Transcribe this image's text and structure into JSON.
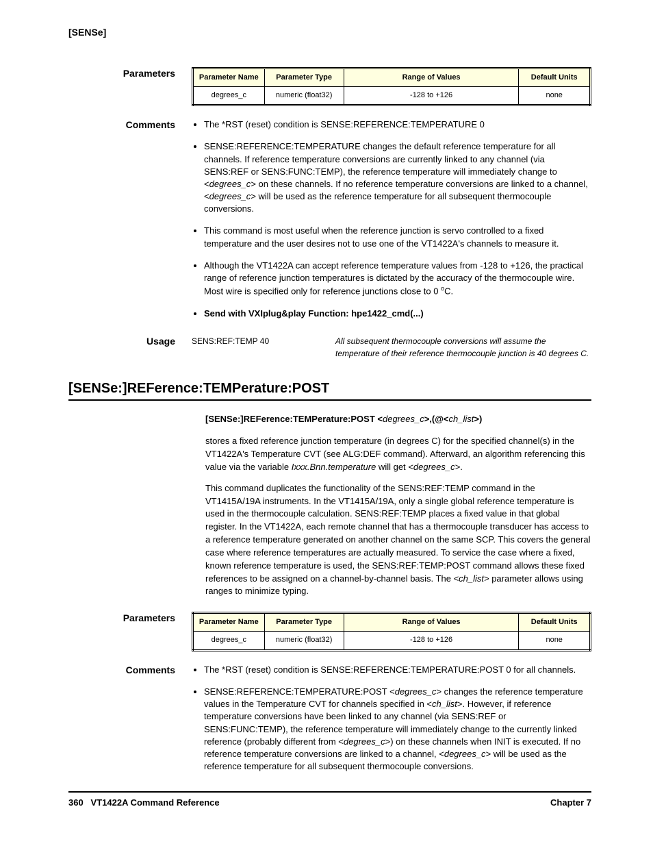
{
  "header": {
    "category": "[SENSe]"
  },
  "sec1": {
    "params_label": "Parameters",
    "table": {
      "headers": [
        "Parameter Name",
        "Parameter Type",
        "Range of Values",
        "Default Units"
      ],
      "row": [
        "degrees_c",
        "numeric (float32)",
        "-128 to +126",
        "none"
      ]
    },
    "comments_label": "Comments",
    "comments": {
      "c1": "The *RST (reset) condition is SENSE:REFERENCE:TEMPERATURE 0",
      "c2_a": "SENSE:REFERENCE:TEMPERATURE changes the default reference temperature for all channels. If reference temperature conversions are currently linked to any channel (via SENS:REF or SENS:FUNC:TEMP), the reference temperature will immediately change to <",
      "c2_b": "> on these channels. If no reference temperature conversions are linked to a channel, <",
      "c2_c": "> will be used as the reference temperature for all subsequent thermocouple conversions.",
      "c2_i": "degrees_c",
      "c3": "This command is most useful when the reference junction is servo controlled to a fixed temperature and the user desires not to use one of the VT1422A's channels to measure it.",
      "c4_a": "Although the VT1422A can accept reference temperature values from -128 to +126, the practical range of reference junction temperatures is dictated by the accuracy of the thermocouple wire. Most wire is specified only for reference junctions close to 0 ",
      "c4_b": "C.",
      "c5": "Send with VXIplug&play Function: hpe1422_cmd(...)"
    },
    "usage_label": "Usage",
    "usage": {
      "cmd": "SENS:REF:TEMP 40",
      "comment": "All subsequent thermocouple conversions will assume the temperature of their reference thermocouple junction is 40 degrees C."
    }
  },
  "cmd2": {
    "heading": "[SENSe:]REFerence:TEMPerature:POST",
    "syntax": {
      "bold_a": "[SENSe:]REFerence:TEMPerature:POST  <",
      "i1": "degrees_c",
      "bold_b": ">,(@<",
      "i2": "ch_list",
      "bold_c": ">)"
    },
    "desc": {
      "p1_a": "stores a fixed reference junction temperature (in degrees C) for the specified channel(s) in the VT1422A's Temperature CVT (see ALG:DEF command). Afterward, an algorithm referencing this value via the variable ",
      "p1_b": " will get ",
      "p1_c": ".",
      "p1_i1": "Ixxx.Bnn.temperature",
      "p1_i2": "<degrees_c>",
      "p2_a": "This command duplicates the functionality of the SENS:REF:TEMP command in the VT1415A/19A instruments. In the VT1415A/19A, only a single global reference temperature is used in the thermocouple calculation. SENS:REF:TEMP places a fixed value in that global register. In the VT1422A, each remote channel that has a thermocouple transducer has access to a reference temperature generated on another channel on the same SCP. This covers the general case where reference temperatures are actually measured. To service the case where a fixed, known reference temperature is used, the SENS:REF:TEMP:POST command allows these fixed references to be assigned on a channel-by-channel basis. The ",
      "p2_b": " parameter allows using ranges to minimize typing.",
      "p2_i": "<ch_list>"
    },
    "params_label": "Parameters",
    "table": {
      "headers": [
        "Parameter Name",
        "Parameter Type",
        "Range of Values",
        "Default Units"
      ],
      "row": [
        "degrees_c",
        "numeric (float32)",
        "-128 to +126",
        "none"
      ]
    },
    "comments_label": "Comments",
    "comments": {
      "c1": "The *RST (reset) condition is SENSE:REFERENCE:TEMPERATURE:POST 0 for all channels.",
      "c2_a": "SENSE:REFERENCE:TEMPERATURE:POST <",
      "c2_b": "> changes the reference temperature values in the Temperature CVT for channels specified in <",
      "c2_c": ">. However, if reference temperature conversions have been linked to any channel (via SENS:REF or SENS:FUNC:TEMP), the reference temperature will immediately change to the currently linked reference (probably different from <",
      "c2_d": ">) on these channels when INIT is executed. If no reference temperature conversions are linked to a channel, <",
      "c2_e": "> will be used as the reference temperature for all subsequent thermocouple conversions.",
      "c2_i1": "degrees_c",
      "c2_i2": "ch_list",
      "c2_i3": "degrees_c",
      "c2_i4": "degrees_c"
    }
  },
  "footer": {
    "page": "360",
    "title": "VT1422A Command Reference",
    "chapter": "Chapter 7"
  }
}
